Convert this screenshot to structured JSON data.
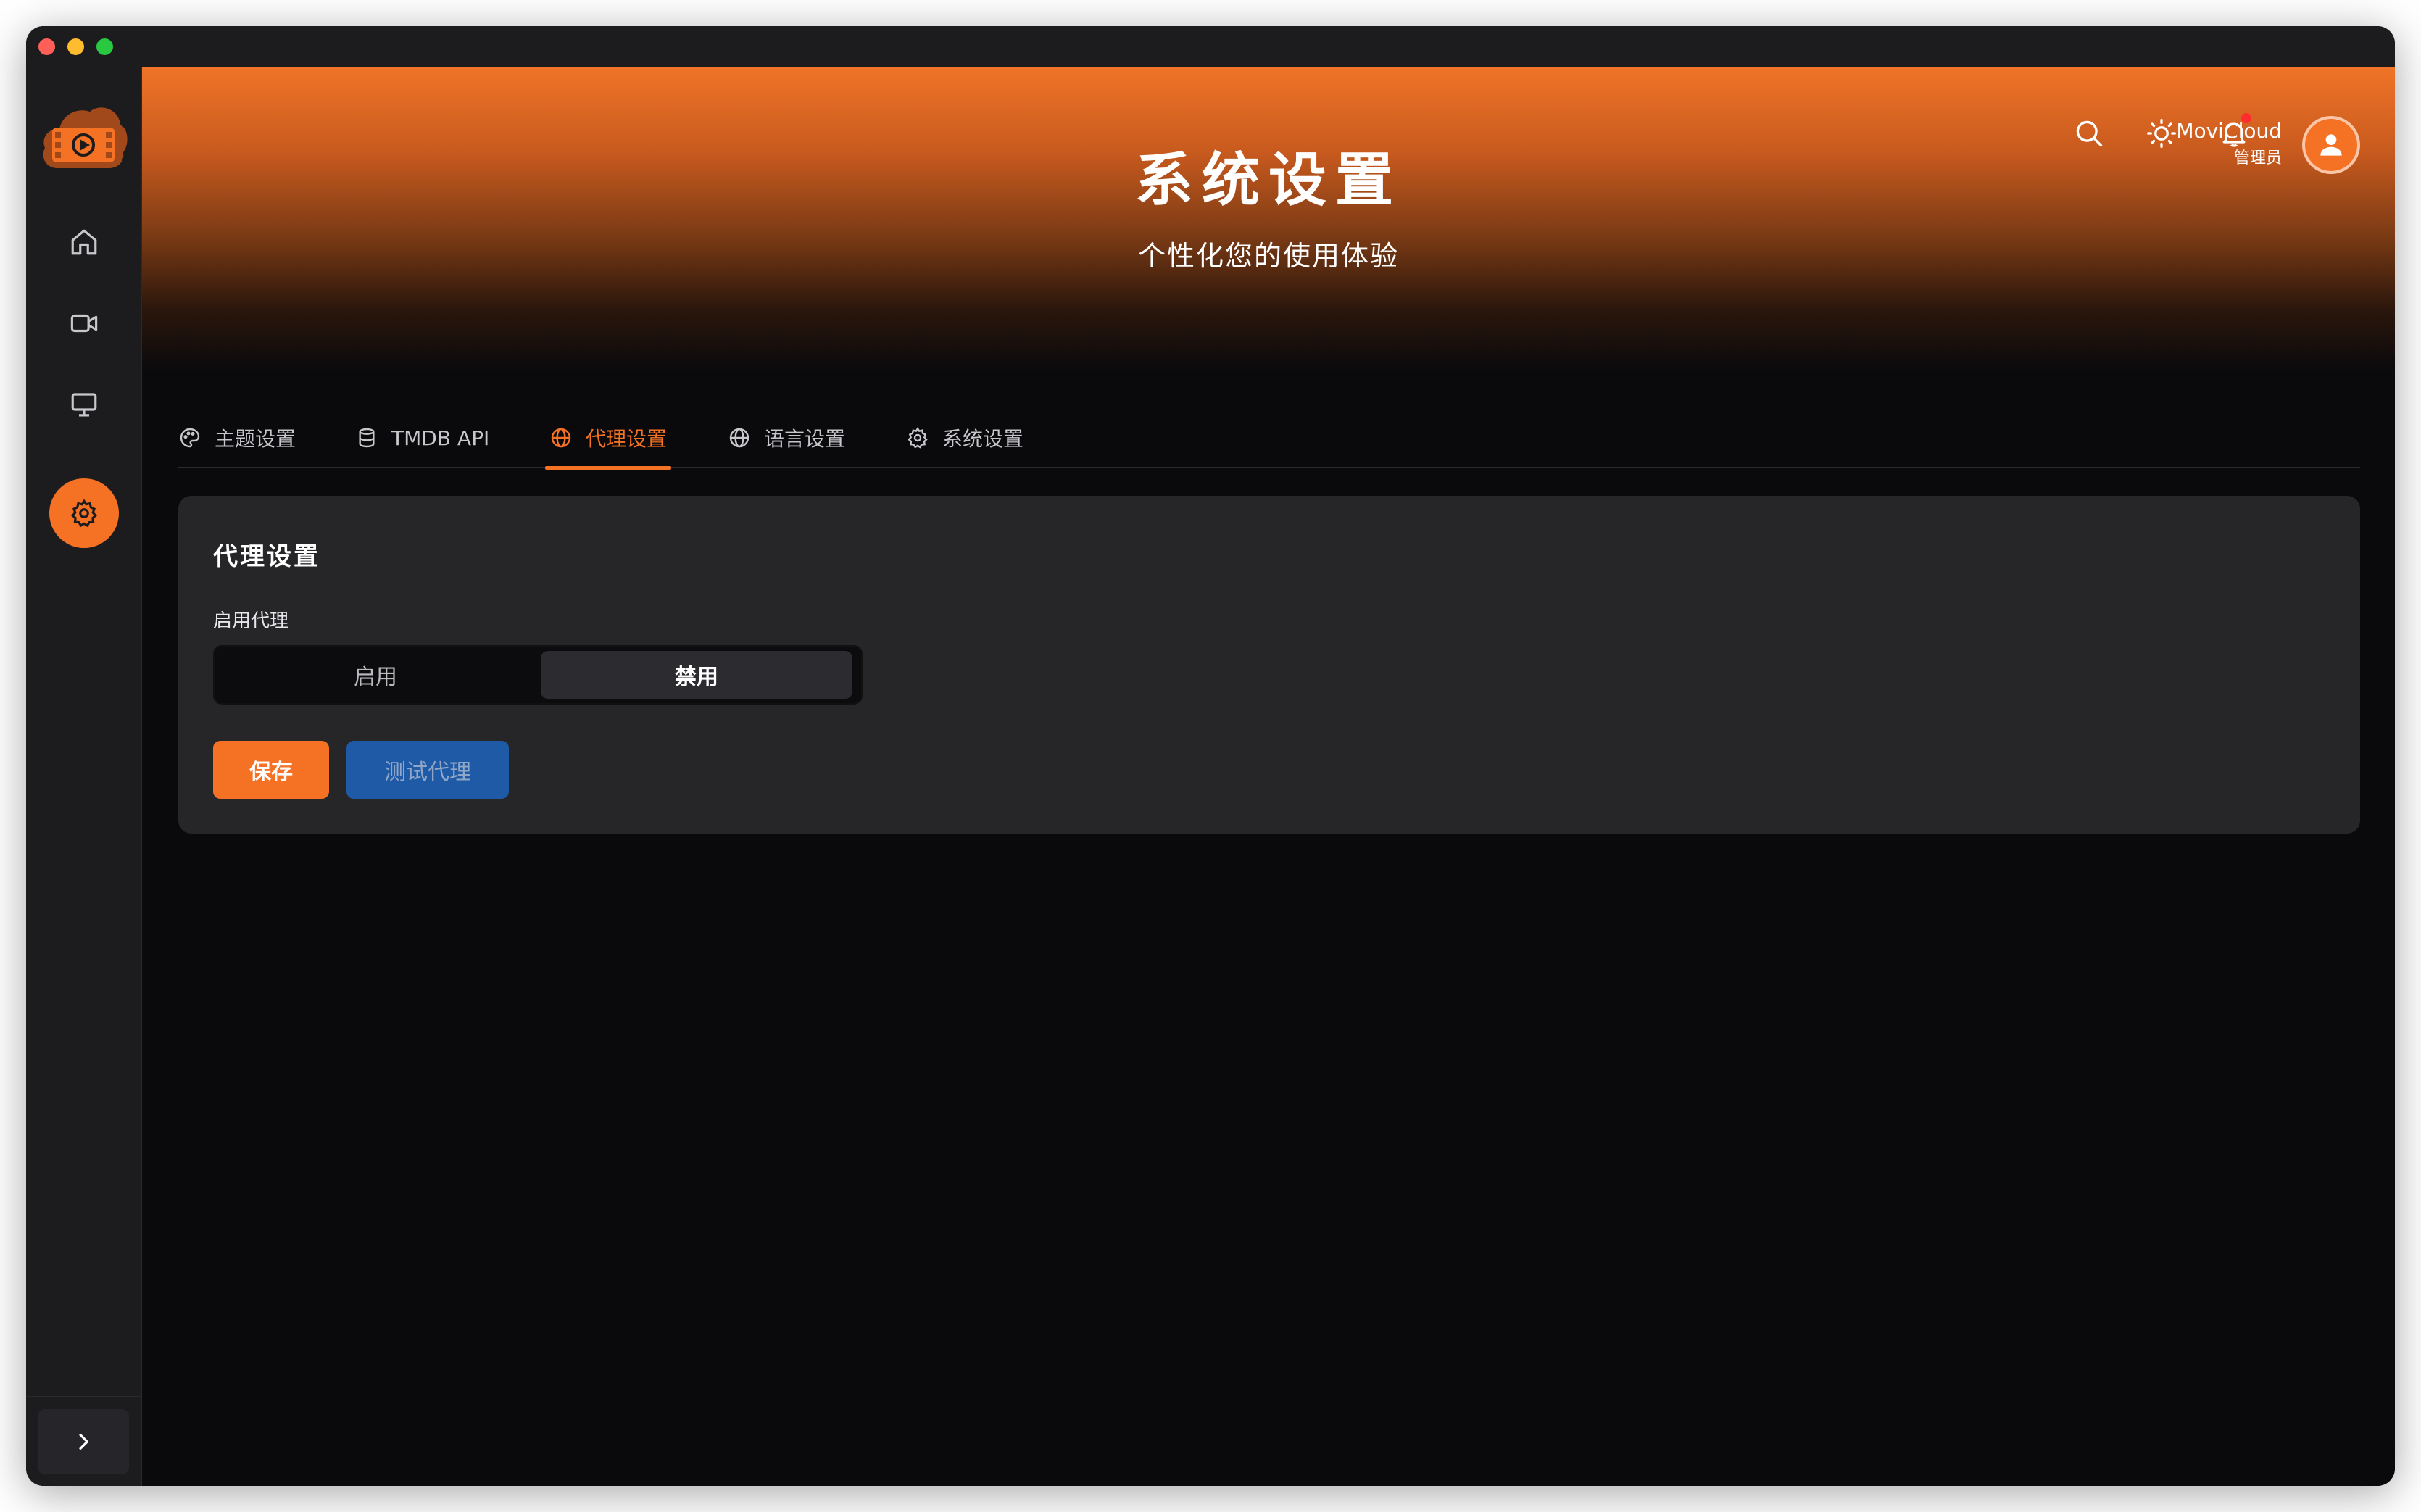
{
  "header": {
    "title": "系统设置",
    "subtitle": "个性化您的使用体验",
    "user_name": "MoviCloud",
    "user_role": "管理员"
  },
  "sidebar": {
    "items": [
      {
        "name": "home",
        "icon": "home-icon"
      },
      {
        "name": "videos",
        "icon": "video-icon"
      },
      {
        "name": "display",
        "icon": "monitor-icon"
      },
      {
        "name": "settings",
        "icon": "gear-icon",
        "active": true
      }
    ]
  },
  "tabs": [
    {
      "label": "主题设置",
      "icon": "palette-icon"
    },
    {
      "label": "TMDB API",
      "icon": "database-icon"
    },
    {
      "label": "代理设置",
      "icon": "globe-icon",
      "active": true
    },
    {
      "label": "语言设置",
      "icon": "globe-icon"
    },
    {
      "label": "系统设置",
      "icon": "gear-icon"
    }
  ],
  "proxy": {
    "title": "代理设置",
    "enable_label": "启用代理",
    "options": [
      "启用",
      "禁用"
    ],
    "selected": "禁用",
    "save_label": "保存",
    "test_label": "测试代理"
  },
  "colors": {
    "accent": "#f57224",
    "test_button": "#1f5aa6",
    "background": "#0a0a0c",
    "card": "#262628"
  }
}
